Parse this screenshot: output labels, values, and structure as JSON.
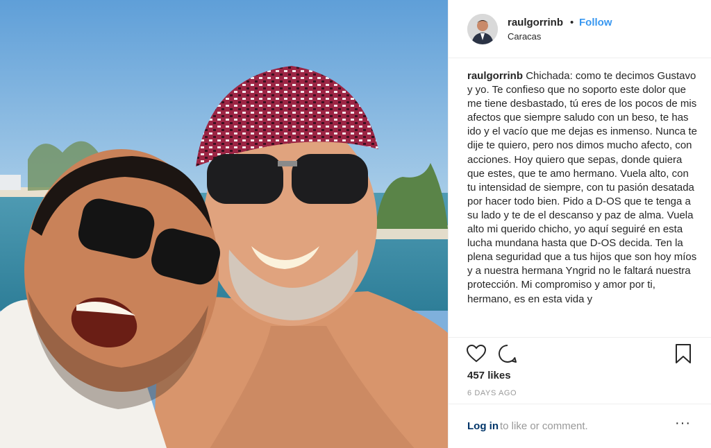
{
  "author": {
    "username": "raulgorrinb",
    "location": "Caracas",
    "separator": "•",
    "follow_label": "Follow"
  },
  "caption": {
    "username": "raulgorrinb",
    "text": "Chichada: como te decimos Gustavo y yo. Te confieso que no soporto este dolor que me tiene desbastado, tú eres de los pocos de mis afectos que siempre saludo con un beso, te has ido y el vacío que me dejas es inmenso. Nunca te dije te quiero, pero nos dimos mucho afecto, con acciones. Hoy quiero que sepas, donde quiera que estes, que te amo hermano. Vuela alto, con tu intensidad de siempre, con tu pasión desatada por hacer todo bien. Pido a D-OS que te tenga a su lado y te de el descanso y paz de alma. Vuela alto mi querido chicho, yo aquí seguiré en esta lucha mundana hasta que D-OS decida. Ten la plena seguridad que a tus hijos que son hoy míos y a nuestra hermana Yngrid no le faltará nuestra protección. Mi compromiso y amor por ti, hermano, es en esta vida y"
  },
  "stats": {
    "likes": "457 likes",
    "posted": "6 DAYS AGO"
  },
  "comment_bar": {
    "login_label": "Log in",
    "rest_text": "to like or comment.",
    "more_label": "···"
  },
  "icons": {
    "like": "heart-icon",
    "comment": "comment-icon",
    "save": "bookmark-icon",
    "more": "more-options-icon"
  },
  "colors": {
    "link_blue": "#3897f0",
    "login_blue": "#003569",
    "muted_gray": "#999999",
    "text": "#262626"
  }
}
